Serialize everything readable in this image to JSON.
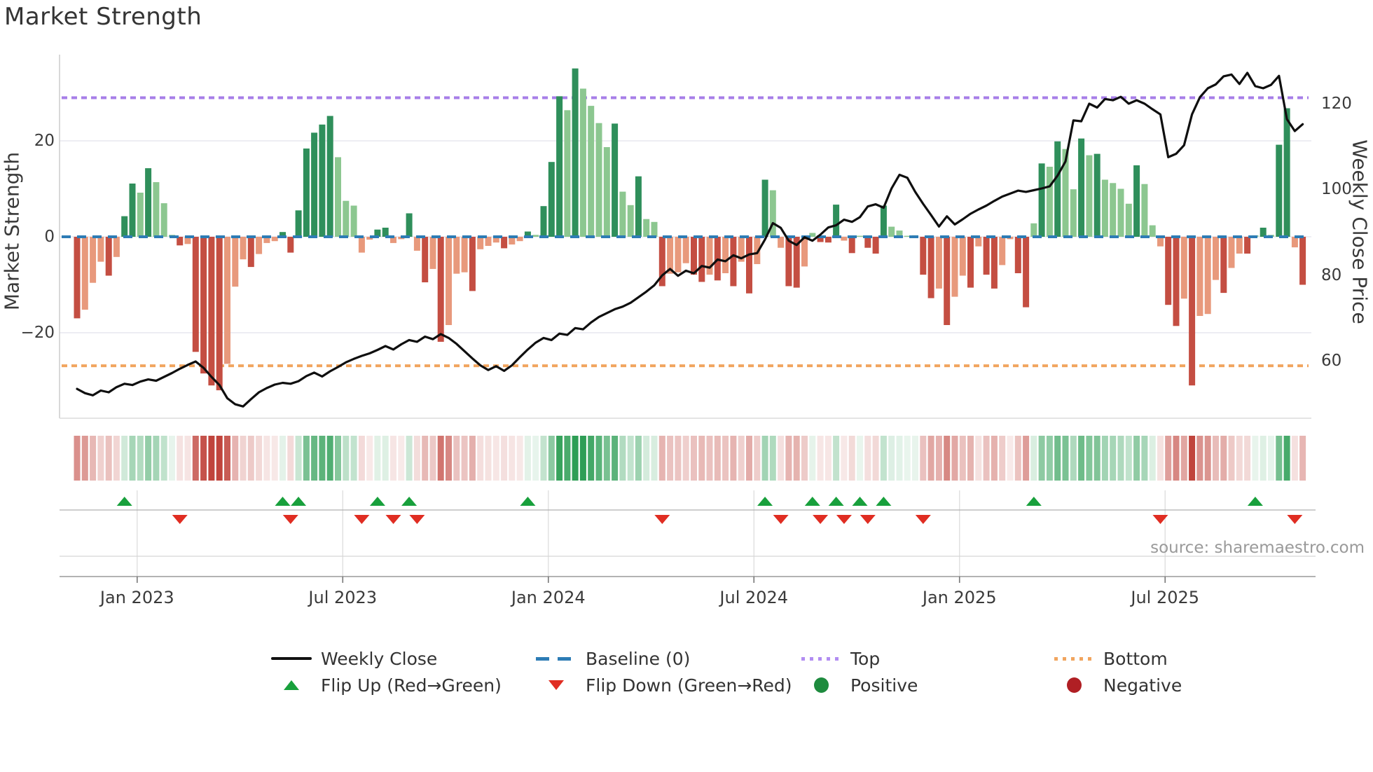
{
  "title": "Market Strength",
  "source": "source: sharemaestro.com",
  "axes": {
    "left_label": "Market Strength",
    "right_label": "Weekly Close Price",
    "left_ticks": [
      {
        "label": "20",
        "value": 20
      },
      {
        "label": "0",
        "value": 0
      },
      {
        "label": "−20",
        "value": -20
      }
    ],
    "right_ticks": [
      {
        "label": "120",
        "value": 120
      },
      {
        "label": "100",
        "value": 100
      },
      {
        "label": "80",
        "value": 80
      },
      {
        "label": "60",
        "value": 60
      }
    ],
    "x_ticks": [
      "Jan 2023",
      "Jul 2023",
      "Jan 2024",
      "Jul 2024",
      "Jan 2025",
      "Jul 2025"
    ]
  },
  "legend": {
    "items": [
      {
        "label": "Weekly Close",
        "type": "line",
        "color": "#111111"
      },
      {
        "label": "Baseline (0)",
        "type": "dashed",
        "color": "#2d7cb5"
      },
      {
        "label": "Top",
        "type": "dotted",
        "color": "#b28df2"
      },
      {
        "label": "Bottom",
        "type": "dotted",
        "color": "#f1a55f"
      },
      {
        "label": "Flip Up (Red→Green)",
        "type": "triangle-up",
        "color": "#18a03c"
      },
      {
        "label": "Flip Down (Green→Red)",
        "type": "triangle-down",
        "color": "#e02d22"
      },
      {
        "label": "Positive",
        "type": "dot",
        "color": "#1e8b3e"
      },
      {
        "label": "Negative",
        "type": "dot",
        "color": "#b01f24"
      }
    ]
  },
  "palette": {
    "bar_pos_strong": "#2f8f5b",
    "bar_pos_soft": "#8cc790",
    "bar_neg_strong": "#c44e42",
    "bar_neg_soft": "#e8997c",
    "price_line": "#0f0f0f",
    "baseline": "#2d7cb5",
    "top_line": "#a77ee8",
    "bottom_line": "#f1a55f",
    "flip_up": "#18a03c",
    "flip_down": "#e02d22",
    "heat_pos": "#2e9e55",
    "heat_neg": "#c0443c",
    "grid": "#e9e9f0",
    "spine": "#cfcfcf",
    "panel_line": "#b0b0b0",
    "panel_line2": "#d5d5d5",
    "panel_spine": "#9a9a9a"
  },
  "chart_data": {
    "type": "combo",
    "title": "Market Strength",
    "x_unit": "weekly, Nov 2022 – Oct 2025",
    "x_tick_labels": [
      "Jan 2023",
      "Jul 2023",
      "Jan 2024",
      "Jul 2024",
      "Jan 2025",
      "Jul 2025"
    ],
    "x_tick_week_index": [
      7.6,
      33.6,
      59.6,
      85.6,
      111.6,
      137.6
    ],
    "left_ylabel": "Market Strength",
    "right_ylabel": "Weekly Close Price",
    "left_ylim": [
      -37.8,
      38.0
    ],
    "right_ylim": [
      46.5,
      131.5
    ],
    "left_yticks": [
      20,
      0,
      -20
    ],
    "right_yticks": [
      120,
      100,
      80,
      60
    ],
    "baseline": 0,
    "top_threshold": 29.0,
    "bottom_threshold": -26.9,
    "grid": "horizontal-left-ticks-only",
    "legend_position": "bottom-center",
    "series": [
      {
        "name": "Market Strength",
        "type": "bar",
        "axis": "left",
        "values": [
          -17.0,
          -15.2,
          -9.6,
          -5.2,
          -8.1,
          -4.2,
          4.3,
          11.1,
          9.2,
          14.3,
          11.4,
          7.0,
          0.4,
          -1.8,
          -1.5,
          -24.0,
          -28.5,
          -31.0,
          -32.0,
          -26.5,
          -10.4,
          -4.7,
          -6.3,
          -3.6,
          -1.3,
          -0.9,
          1.0,
          -3.3,
          5.5,
          18.4,
          21.7,
          23.4,
          25.2,
          16.6,
          7.5,
          6.5,
          -3.3,
          -0.6,
          1.5,
          1.9,
          -1.3,
          -0.5,
          4.9,
          -2.9,
          -9.5,
          -6.7,
          -21.9,
          -18.4,
          -7.7,
          -7.4,
          -11.3,
          -2.6,
          -1.9,
          -1.2,
          -2.4,
          -1.6,
          -0.9,
          1.1,
          0.4,
          6.4,
          15.6,
          29.3,
          26.4,
          35.1,
          30.9,
          27.3,
          23.7,
          18.7,
          23.6,
          9.4,
          6.6,
          12.6,
          3.7,
          3.1,
          -10.3,
          -7.7,
          -7.4,
          -5.5,
          -7.9,
          -9.4,
          -7.9,
          -9.1,
          -7.6,
          -10.3,
          -5.2,
          -11.8,
          -5.7,
          11.9,
          9.7,
          -2.3,
          -10.3,
          -10.6,
          -6.2,
          0.8,
          -1.1,
          -1.2,
          6.7,
          -0.8,
          -3.4,
          0.2,
          -2.3,
          -3.5,
          6.5,
          2.1,
          1.3,
          0.2,
          0.3,
          -7.9,
          -12.8,
          -10.8,
          -18.4,
          -12.5,
          -8.1,
          -10.6,
          -2.0,
          -7.9,
          -10.8,
          -5.9,
          -0.5,
          -7.6,
          -14.7,
          2.8,
          15.3,
          14.6,
          19.9,
          18.3,
          9.9,
          20.5,
          17.0,
          17.3,
          11.9,
          11.2,
          10.0,
          6.9,
          14.9,
          11.0,
          2.4,
          -2.0,
          -14.2,
          -18.6,
          -12.9,
          -31.0,
          -16.5,
          -16.1,
          -9.0,
          -11.7,
          -6.5,
          -3.5,
          -3.5,
          0.3,
          1.9,
          0.4,
          19.2,
          26.8,
          -2.2,
          -10.0
        ]
      },
      {
        "name": "Weekly Close",
        "type": "line",
        "axis": "right",
        "values": [
          53.4,
          52.4,
          51.9,
          53.0,
          52.6,
          53.8,
          54.6,
          54.3,
          55.1,
          55.6,
          55.3,
          56.2,
          57.1,
          58.1,
          59.0,
          59.8,
          58.3,
          56.2,
          54.3,
          51.2,
          49.8,
          49.3,
          51.0,
          52.6,
          53.6,
          54.4,
          54.8,
          54.6,
          55.2,
          56.4,
          57.2,
          56.3,
          57.5,
          58.5,
          59.6,
          60.4,
          61.1,
          61.7,
          62.5,
          63.4,
          62.6,
          63.8,
          64.8,
          64.4,
          65.6,
          65.0,
          66.2,
          65.3,
          63.9,
          62.2,
          60.5,
          58.9,
          57.8,
          58.7,
          57.6,
          58.9,
          60.8,
          62.6,
          64.2,
          65.3,
          64.8,
          66.3,
          66.0,
          67.6,
          67.3,
          68.9,
          70.2,
          71.1,
          72.0,
          72.6,
          73.5,
          74.8,
          76.1,
          77.6,
          79.9,
          81.4,
          79.8,
          81.0,
          80.4,
          82.1,
          81.7,
          83.6,
          83.2,
          84.6,
          83.9,
          84.8,
          85.1,
          88.3,
          92.1,
          91.0,
          88.0,
          87.0,
          88.8,
          88.0,
          89.4,
          91.1,
          91.6,
          92.9,
          92.4,
          93.5,
          96.0,
          96.5,
          95.7,
          100.2,
          103.4,
          102.7,
          99.4,
          96.6,
          94.0,
          91.3,
          93.7,
          91.8,
          93.0,
          94.3,
          95.3,
          96.2,
          97.3,
          98.3,
          99.0,
          99.7,
          99.4,
          99.8,
          100.2,
          100.7,
          103.2,
          106.5,
          116.1,
          115.9,
          120.0,
          119.1,
          121.1,
          120.8,
          121.6,
          120.0,
          120.8,
          120.0,
          118.7,
          117.5,
          107.5,
          108.3,
          110.3,
          117.5,
          121.5,
          123.6,
          124.5,
          126.4,
          126.8,
          124.6,
          127.2,
          124.1,
          123.6,
          124.4,
          126.5,
          116.4,
          113.6,
          115.2
        ]
      }
    ],
    "heatmap": "bar values repeated as red/green intensity strip below chart",
    "flip_up_weeks": [
      6,
      26,
      28,
      38,
      42,
      57,
      87,
      93,
      96,
      99,
      102,
      121,
      149
    ],
    "flip_down_weeks": [
      13,
      27,
      36,
      40,
      43,
      74,
      89,
      94,
      97,
      100,
      107,
      137,
      154
    ]
  }
}
